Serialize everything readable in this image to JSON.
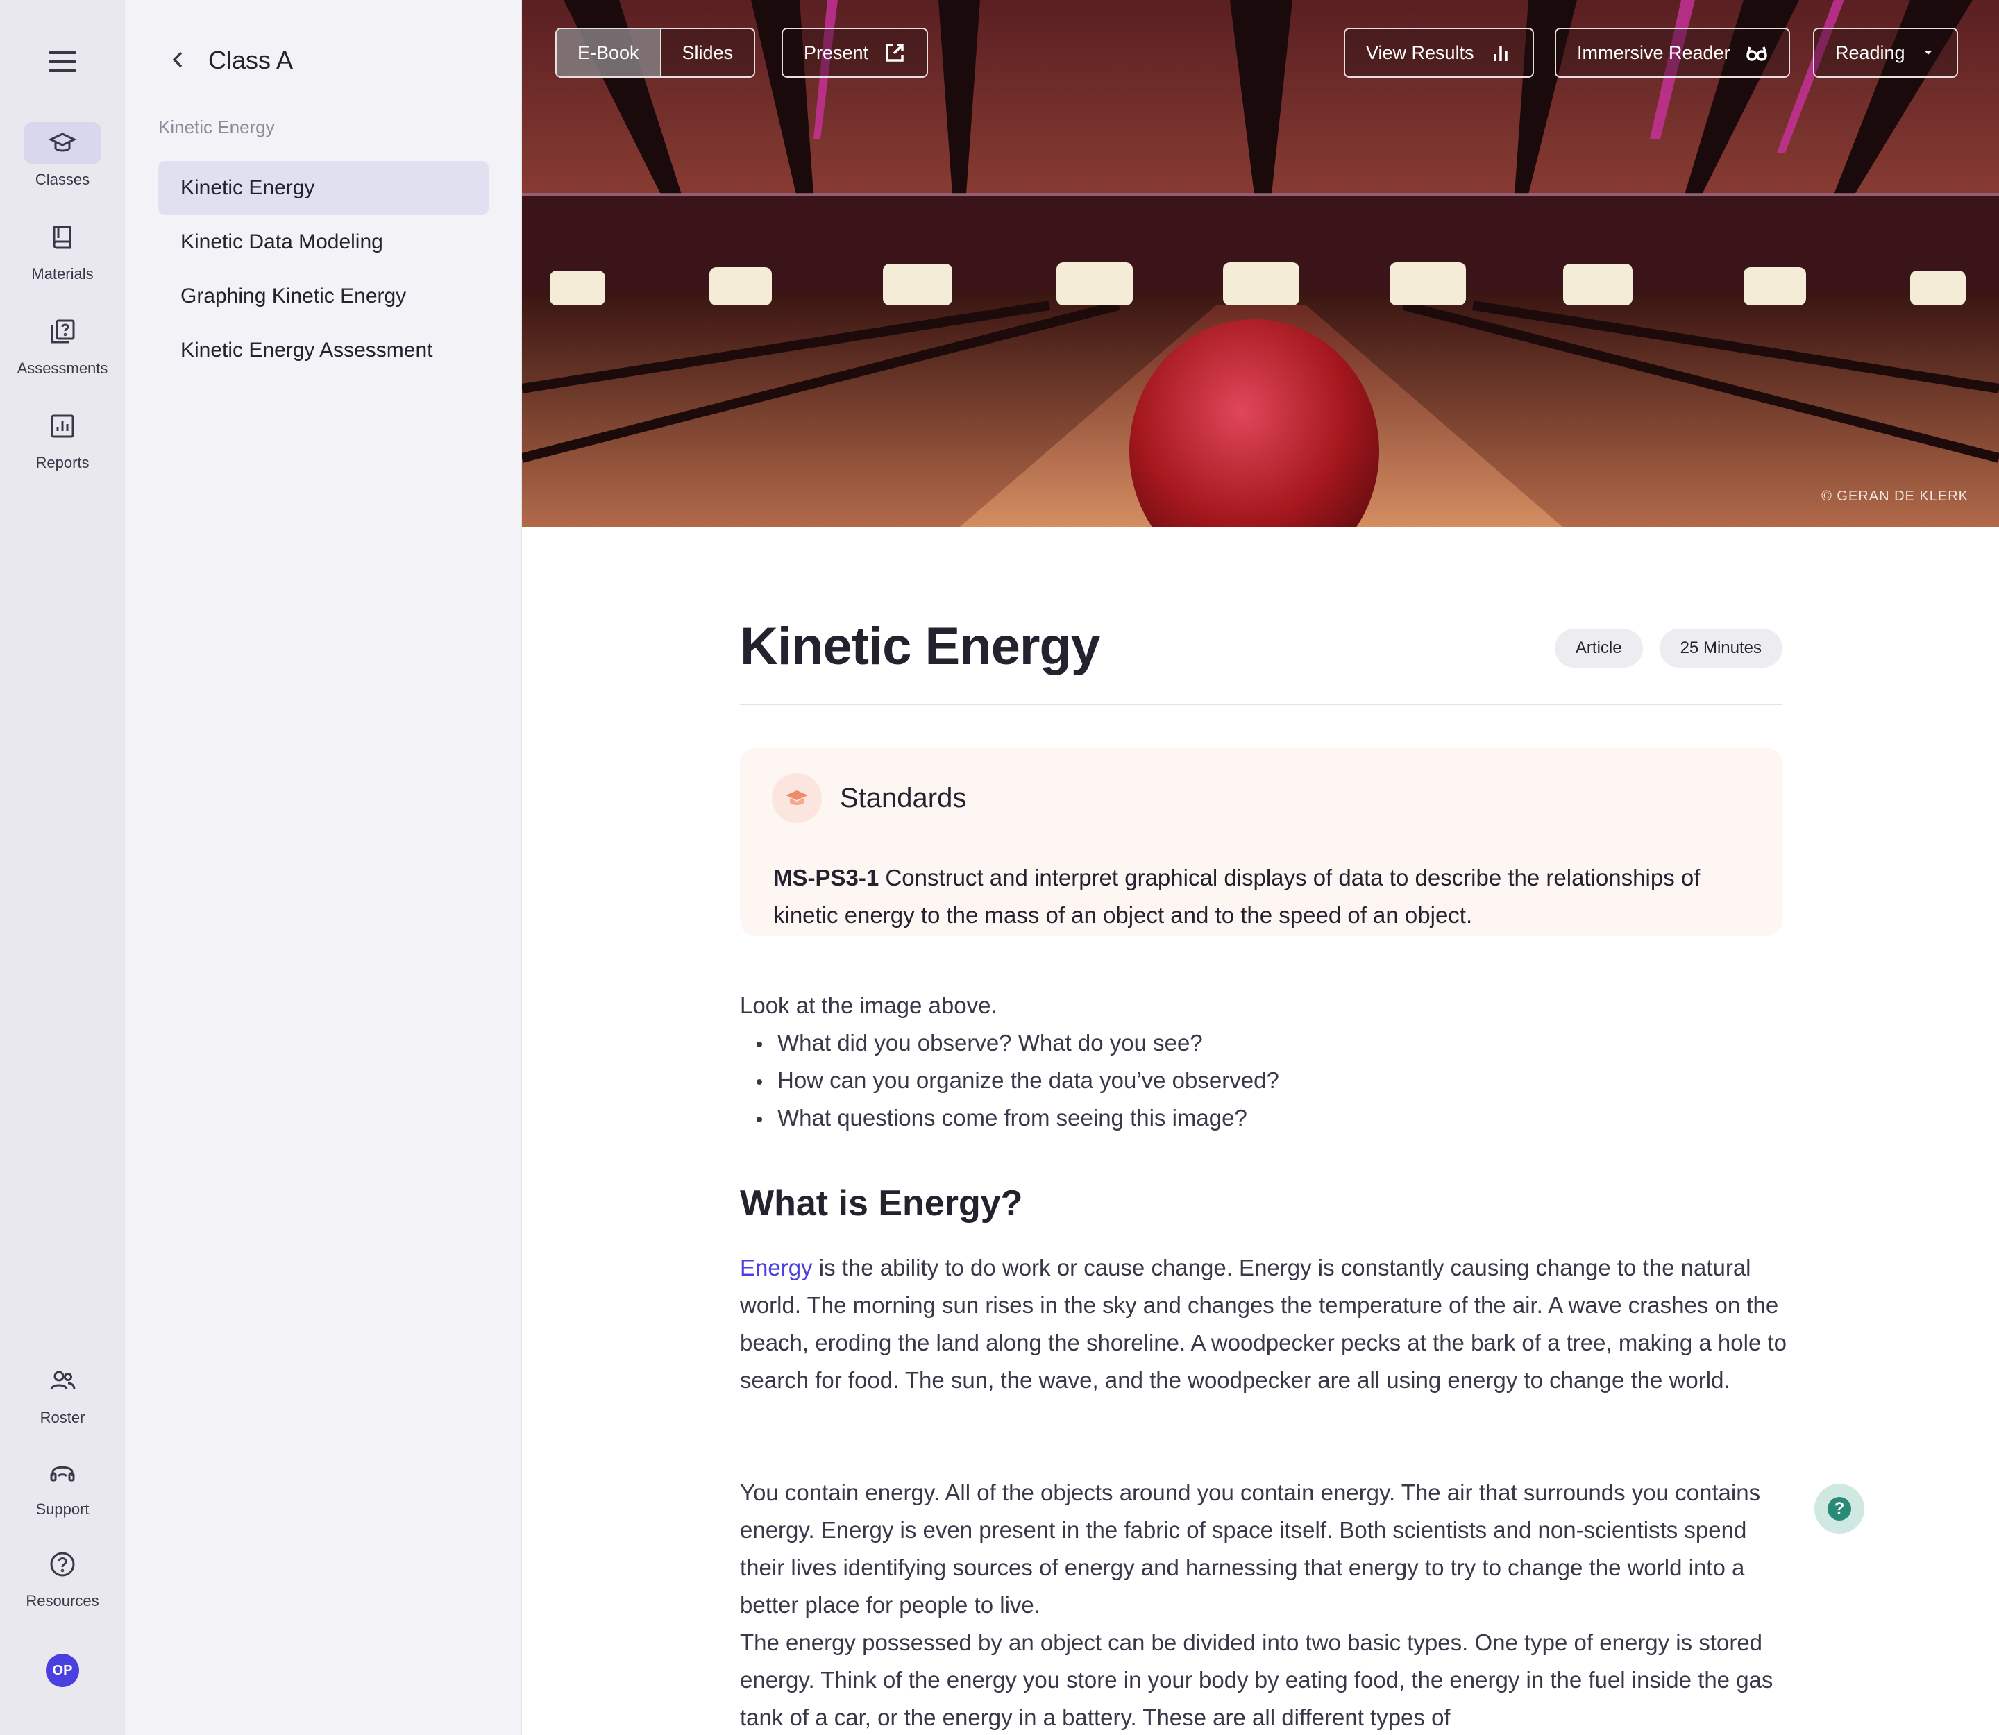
{
  "rail": {
    "items": [
      {
        "label": "Classes",
        "icon": "graduation-cap-icon"
      },
      {
        "label": "Materials",
        "icon": "book-icon"
      },
      {
        "label": "Assessments",
        "icon": "question-pages-icon"
      },
      {
        "label": "Reports",
        "icon": "bar-chart-icon"
      }
    ],
    "bottom": [
      {
        "label": "Roster",
        "icon": "people-icon"
      },
      {
        "label": "Support",
        "icon": "headset-icon"
      },
      {
        "label": "Resources",
        "icon": "help-circle-icon"
      }
    ],
    "avatar_initials": "OP",
    "avatar_color": "#4a3fe0"
  },
  "sidebar": {
    "title": "Class A",
    "section": "Kinetic Energy",
    "items": [
      {
        "label": "Kinetic Energy"
      },
      {
        "label": "Kinetic Data Modeling"
      },
      {
        "label": "Graphing Kinetic Energy"
      },
      {
        "label": "Kinetic Energy Assessment"
      }
    ]
  },
  "toolbar": {
    "ebook": "E-Book",
    "slides": "Slides",
    "present": "Present",
    "view_results": "View Results",
    "immersive_reader": "Immersive Reader",
    "reading": "Reading"
  },
  "hero": {
    "credit": "© GERAN DE KLERK"
  },
  "article": {
    "title": "Kinetic Energy",
    "chips": [
      "Article",
      "25 Minutes"
    ],
    "standards": {
      "heading": "Standards",
      "code": "MS-PS3-1",
      "text": " Construct and interpret graphical displays of data to describe the relationships of kinetic energy to the mass of an object and to the speed of an object."
    },
    "intro": "Look at the image above.",
    "bullets": [
      "What did you observe? What do you see?",
      "How can you organize the data you’ve observed?",
      "What questions come from seeing this image?"
    ],
    "heading2": "What is Energy?",
    "p1_keyword": "Energy",
    "p1_rest": " is the ability to do work or cause change. Energy is constantly causing change to the natural world. The morning sun rises in the sky and changes the temperature of the air. A wave crashes on the beach, eroding the land along the shoreline. A woodpecker pecks at the bark of a tree, making a hole to search for food. The sun, the wave, and the woodpecker are all using energy to change the world.",
    "p2": "You contain energy. All of the objects around you contain energy. The air that surrounds you contains energy. Energy is even present in the fabric of space itself. Both scientists and non-scientists spend their lives identifying sources of energy and harnessing that energy to try to change the world into a better place for people to live.",
    "p3": "The energy possessed by an object can be divided into two basic types. One type of energy is stored energy. Think of the energy you store in your body by eating food, the energy in the fuel inside the gas tank of a car, or the energy in a battery. These are all different types of"
  },
  "help_label": "?",
  "colors": {
    "accent": "#4a3fe0",
    "standards_bg": "#fdf6f3",
    "help": "#2a8a77"
  }
}
